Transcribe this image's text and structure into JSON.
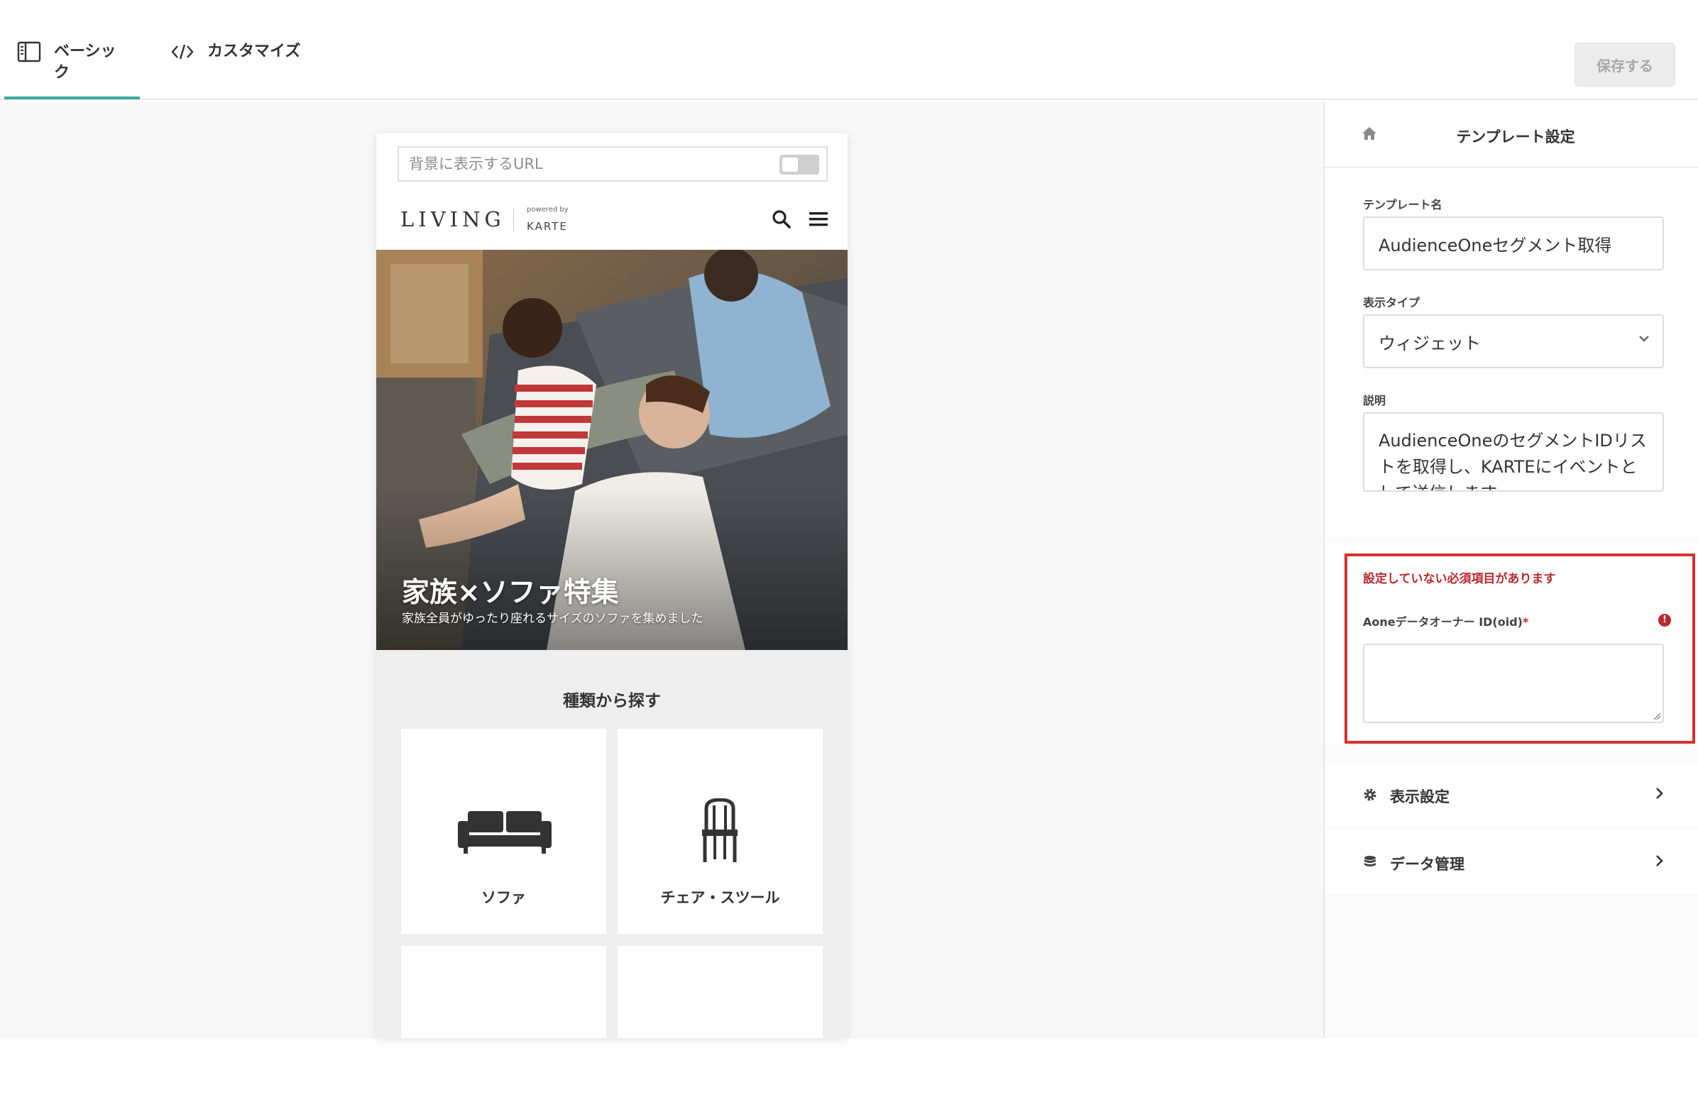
{
  "tabs": [
    {
      "label": "ベーシック",
      "icon": "sidebar-layout-icon",
      "active": true
    },
    {
      "label": "カスタマイズ",
      "icon": "code-brackets-icon",
      "active": false
    }
  ],
  "toolbar": {
    "save_label": "保存する"
  },
  "preview": {
    "url_placeholder": "背景に表示するURL",
    "site": {
      "logo": "LIVING",
      "powered_by": "powered by",
      "brand": "KARTE"
    },
    "hero": {
      "title": "家族×ソファ特集",
      "subtitle": "家族全員がゆったり座れるサイズのソファを集めました"
    },
    "browse": {
      "title": "種類から探す",
      "categories": [
        {
          "label": "ソファ",
          "icon": "sofa-icon"
        },
        {
          "label": "チェア・スツール",
          "icon": "chair-icon"
        },
        {
          "label": "",
          "icon": ""
        },
        {
          "label": "",
          "icon": ""
        }
      ]
    }
  },
  "panel": {
    "title": "テンプレート設定",
    "fields": {
      "name_label": "テンプレート名",
      "name_value": "AudienceOneセグメント取得",
      "type_label": "表示タイプ",
      "type_value": "ウィジェット",
      "desc_label": "説明",
      "desc_value": "AudienceOneのセグメントIDリストを取得し、KARTEにイベントとして送信します"
    },
    "required": {
      "message": "設定していない必須項目があります",
      "field_label": "Aoneデータオーナー ID(oid)",
      "asterisk": "*",
      "field_value": ""
    },
    "sections": [
      {
        "label": "表示設定",
        "icon": "gear-icon"
      },
      {
        "label": "データ管理",
        "icon": "database-icon"
      }
    ]
  },
  "colors": {
    "accent": "#3aa7a0",
    "error": "#d9302b"
  }
}
